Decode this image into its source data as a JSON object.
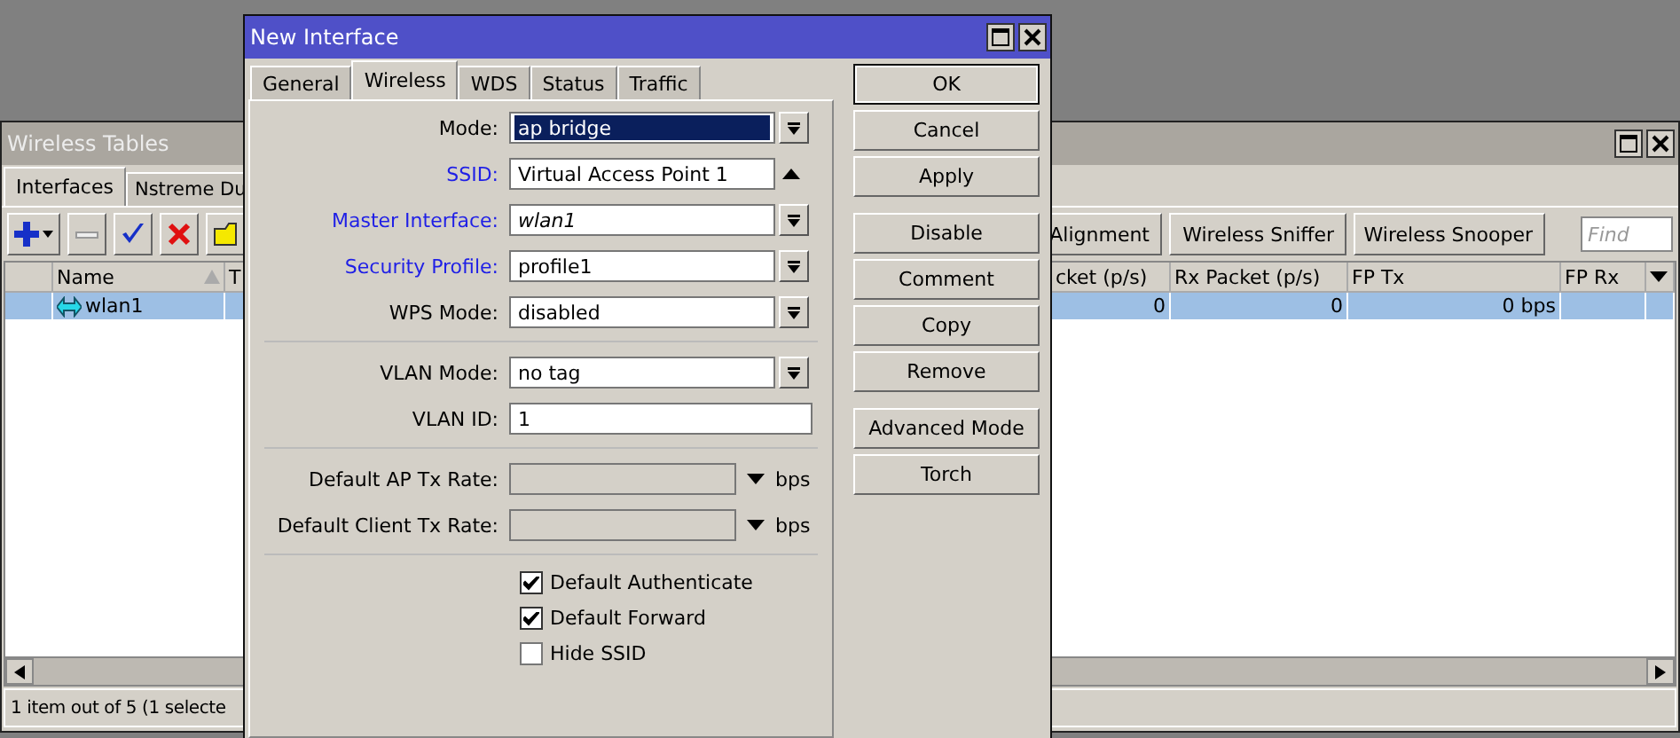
{
  "background_window": {
    "title": "Wireless Tables",
    "tabs": [
      {
        "label": "Interfaces",
        "selected": true
      },
      {
        "label": "Nstreme Du",
        "selected": false
      }
    ],
    "toolbar_buttons": [
      "Alignment",
      "Wireless Sniffer",
      "Wireless Snooper"
    ],
    "find": {
      "placeholder": "Find"
    },
    "table": {
      "columns": [
        "Name",
        "T",
        "cket (p/s)",
        "Rx Packet (p/s)",
        "FP Tx",
        "FP Rx"
      ],
      "rows": [
        {
          "selected": true,
          "cells": [
            "wlan1",
            "0",
            "0",
            "0 bps"
          ]
        }
      ]
    },
    "status_bar": "1 item out of 5 (1 selecte"
  },
  "dialog": {
    "title": "New Interface",
    "tabs": [
      {
        "label": "General",
        "selected": false
      },
      {
        "label": "Wireless",
        "selected": true
      },
      {
        "label": "WDS",
        "selected": false
      },
      {
        "label": "Status",
        "selected": false
      },
      {
        "label": "Traffic",
        "selected": false
      }
    ],
    "field_groups": [
      [
        {
          "label": "Mode:",
          "color": "#000000",
          "kind": "select",
          "value": "ap bridge",
          "focused": true,
          "italic": false
        },
        {
          "label": "SSID:",
          "color": "#1f1fe6",
          "kind": "combo",
          "value": "Virtual Access Point 1",
          "focused": false,
          "italic": false
        },
        {
          "label": "Master Interface:",
          "color": "#1f1fe6",
          "kind": "select",
          "value": "wlan1",
          "focused": false,
          "italic": true
        },
        {
          "label": "Security Profile:",
          "color": "#1f1fe6",
          "kind": "select",
          "value": "profile1",
          "focused": false,
          "italic": false
        },
        {
          "label": "WPS Mode:",
          "color": "#000000",
          "kind": "select",
          "value": "disabled",
          "focused": false,
          "italic": false
        }
      ],
      [
        {
          "label": "VLAN Mode:",
          "color": "#000000",
          "kind": "select",
          "value": "no tag",
          "focused": false,
          "italic": false
        },
        {
          "label": "VLAN ID:",
          "color": "#000000",
          "kind": "text",
          "value": "1",
          "focused": false,
          "italic": false
        }
      ],
      [
        {
          "label": "Default AP Tx Rate:",
          "color": "#000000",
          "kind": "rate",
          "unit": "bps"
        },
        {
          "label": "Default Client Tx Rate:",
          "color": "#000000",
          "kind": "rate",
          "unit": "bps"
        }
      ]
    ],
    "checkboxes": [
      {
        "label": "Default Authenticate",
        "checked": true
      },
      {
        "label": "Default Forward",
        "checked": true
      },
      {
        "label": "Hide SSID",
        "checked": false
      }
    ],
    "button_groups": [
      [
        {
          "label": "OK",
          "default": true
        },
        {
          "label": "Cancel",
          "default": false
        },
        {
          "label": "Apply",
          "default": false
        }
      ],
      [
        {
          "label": "Disable",
          "default": false
        },
        {
          "label": "Comment",
          "default": false
        },
        {
          "label": "Copy",
          "default": false
        },
        {
          "label": "Remove",
          "default": false
        }
      ],
      [
        {
          "label": "Advanced Mode",
          "default": false
        },
        {
          "label": "Torch",
          "default": false
        }
      ]
    ]
  }
}
